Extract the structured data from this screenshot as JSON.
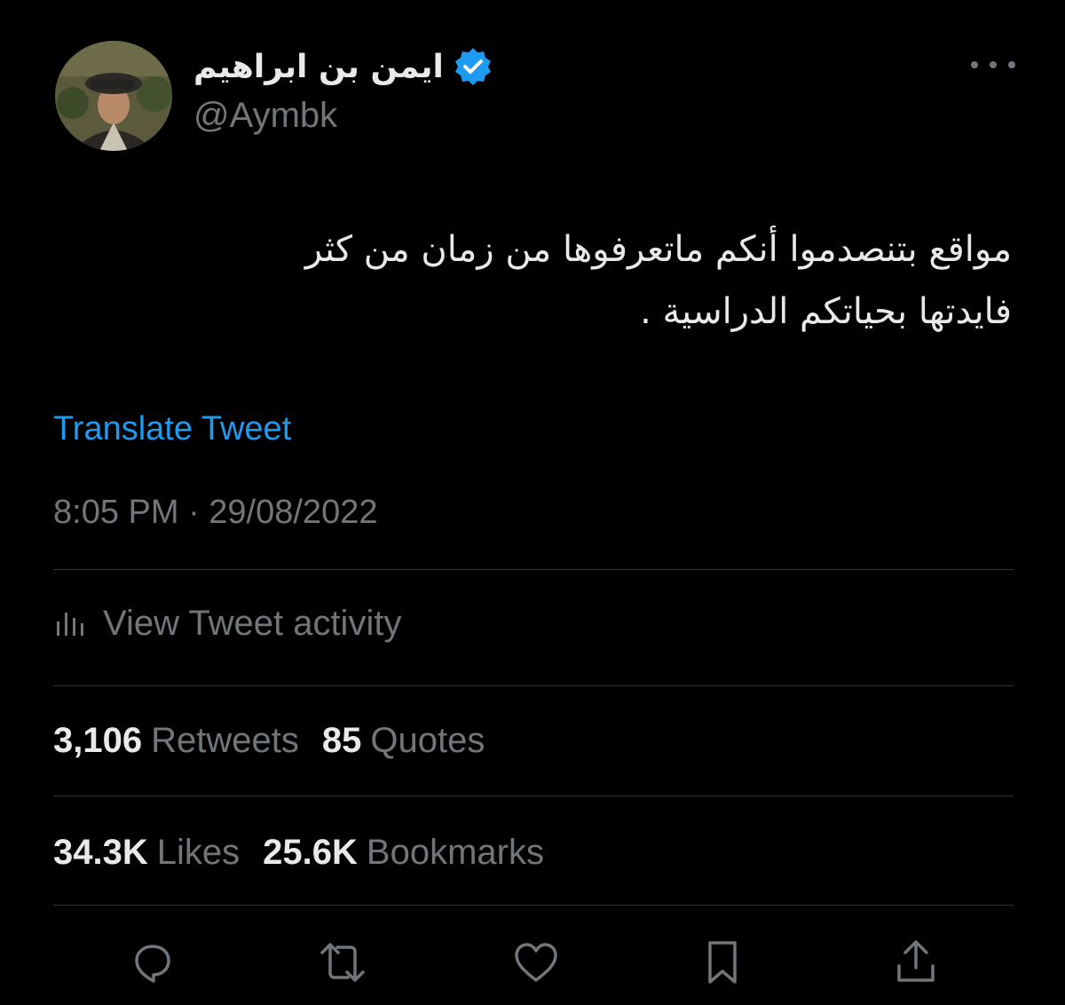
{
  "user": {
    "display_name": "ايمن بن ابراهيم",
    "handle": "@Aymbk",
    "verified": true
  },
  "tweet": {
    "text_line1": "مواقع بتنصدموا أنكم ماتعرفوها من زمان من كثر",
    "text_line2": "فايدتها بحياتكم الدراسية ."
  },
  "translate_label": "Translate Tweet",
  "timestamp": "8:05 PM · 29/08/2022",
  "activity_label": "View Tweet activity",
  "stats": {
    "retweets_count": "3,106",
    "retweets_label": "Retweets",
    "quotes_count": "85",
    "quotes_label": "Quotes",
    "likes_count": "34.3K",
    "likes_label": "Likes",
    "bookmarks_count": "25.6K",
    "bookmarks_label": "Bookmarks"
  },
  "actions": [
    "reply-icon",
    "retweet-icon",
    "like-icon",
    "bookmark-icon",
    "share-icon"
  ],
  "colors": {
    "background": "#000000",
    "text": "#e7e9ea",
    "secondary": "#71767b",
    "accent": "#1d9bf0",
    "divider": "#2f3336"
  }
}
